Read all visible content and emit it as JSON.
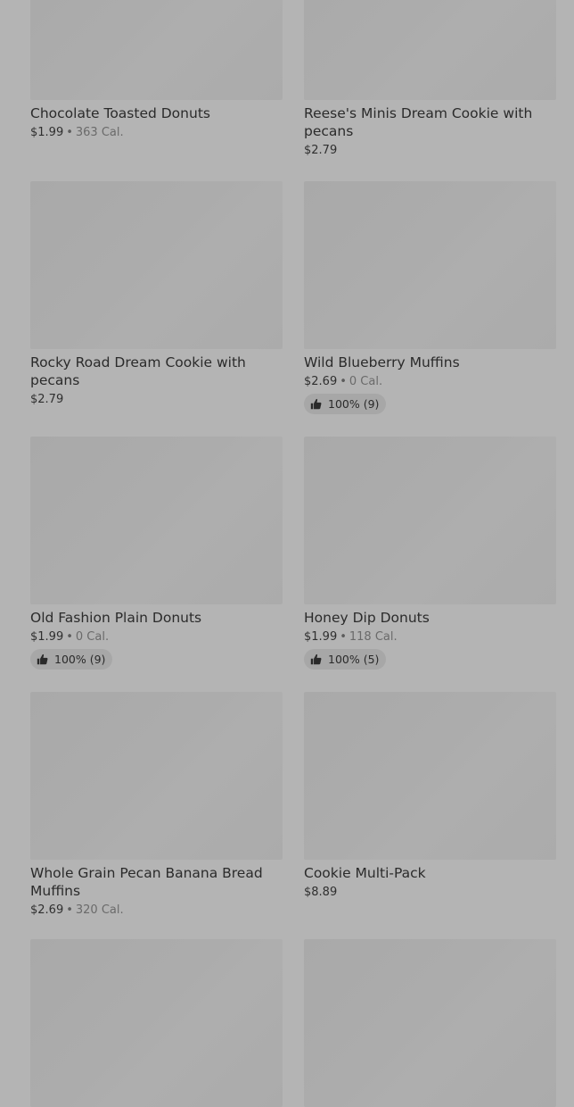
{
  "items": [
    {
      "name": "Chocolate Toasted Donuts",
      "price": "$1.99",
      "separator": "•",
      "calories": "363 Cal.",
      "rating": ""
    },
    {
      "name": "Reese's Minis Dream Cookie with pecans",
      "price": "$2.79",
      "separator": "",
      "calories": "",
      "rating": ""
    },
    {
      "name": "Rocky Road Dream Cookie with pecans",
      "price": "$2.79",
      "separator": "",
      "calories": "",
      "rating": ""
    },
    {
      "name": "Wild Blueberry Muffins",
      "price": "$2.69",
      "separator": "•",
      "calories": "0 Cal.",
      "rating": "100% (9)"
    },
    {
      "name": "Old Fashion Plain Donuts",
      "price": "$1.99",
      "separator": "•",
      "calories": "0 Cal.",
      "rating": "100% (9)"
    },
    {
      "name": "Honey Dip Donuts",
      "price": "$1.99",
      "separator": "•",
      "calories": "118 Cal.",
      "rating": "100% (5)"
    },
    {
      "name": "Whole Grain Pecan Banana Bread Muffins",
      "price": "$2.69",
      "separator": "•",
      "calories": "320 Cal.",
      "rating": ""
    },
    {
      "name": "Cookie Multi-Pack",
      "price": "$8.89",
      "separator": "",
      "calories": "",
      "rating": ""
    }
  ],
  "icons": {
    "rating": "thumbs-up-icon"
  },
  "colors": {
    "background": "#b4b4b4",
    "thumbnail": "#ababab",
    "rating_pill": "#a7a7a7"
  }
}
